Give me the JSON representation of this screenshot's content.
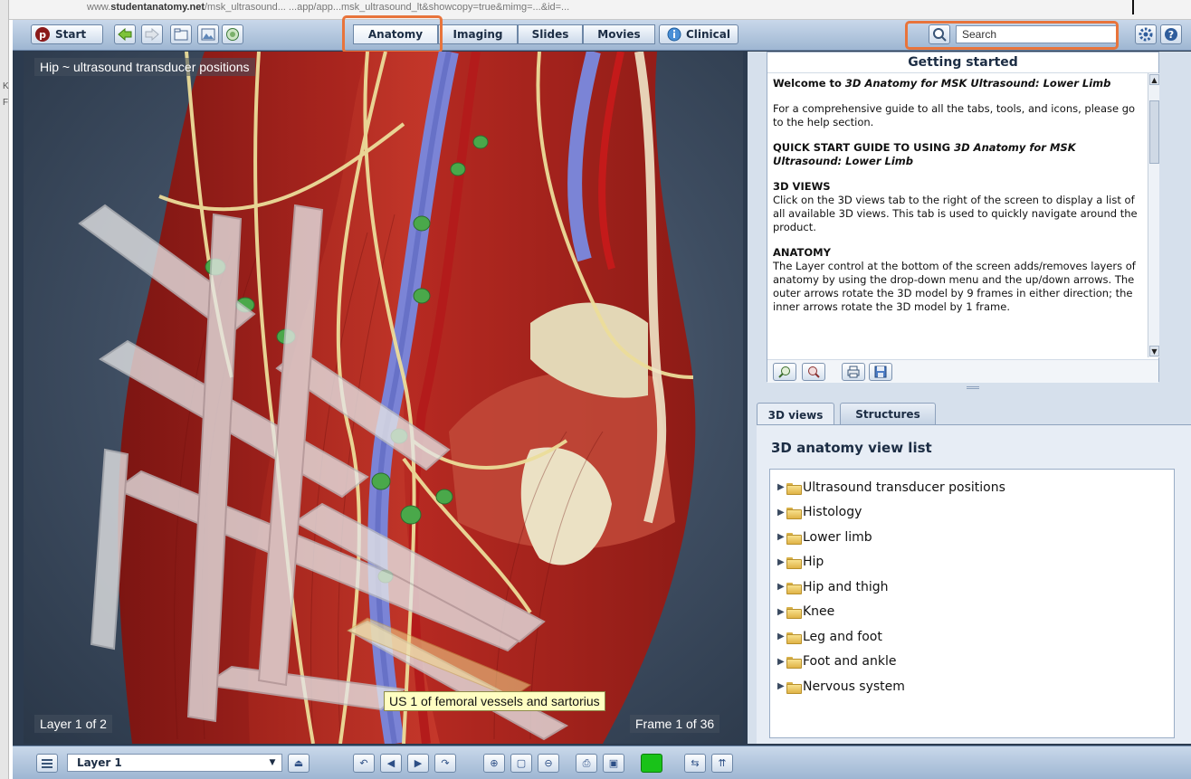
{
  "browser": {
    "url_prefix": "www.",
    "url_domain": "studentanatomy.net",
    "url_rest": "/msk_ultrasound...     ...app/app...msk_ultrasound_lt&showcopy=true&mimg=...&id=..."
  },
  "toolbar": {
    "start_label": "Start",
    "tabs": [
      "Anatomy",
      "Imaging",
      "Slides",
      "Movies"
    ],
    "clinical_label": "Clinical",
    "search_placeholder": "Search"
  },
  "viewer": {
    "title": "Hip ~ ultrasound transducer positions",
    "layer_indicator": "Layer 1 of 2",
    "frame_indicator": "Frame 1 of 36",
    "tooltip": "US 1 of femoral vessels and sartorius"
  },
  "getting_started": {
    "title": "Getting started",
    "welcome_prefix": "Welcome to ",
    "welcome_product": "3D Anatomy for MSK Ultrasound: Lower Limb",
    "intro": "For a comprehensive guide to all the tabs, tools, and icons, please go to the help section.",
    "quick_start_prefix": "QUICK START GUIDE TO USING ",
    "quick_start_product": "3D Anatomy for MSK Ultrasound: Lower Limb",
    "views_heading": "3D VIEWS",
    "views_text": "Click on the 3D views tab to the right of the screen to display a list of all available 3D views. This tab is used to quickly navigate around the product.",
    "anatomy_heading": "ANATOMY",
    "anatomy_text": "The Layer control at the bottom of the screen adds/removes layers of anatomy by using the drop-down menu and the up/down arrows. The outer arrows rotate the 3D model by 9 frames in either direction; the inner arrows rotate the 3D model by 1 frame."
  },
  "views_panel": {
    "tabs": [
      "3D views",
      "Structures"
    ],
    "title": "3D anatomy view list",
    "items": [
      "Ultrasound transducer positions",
      "Histology",
      "Lower limb",
      "Hip",
      "Hip and thigh",
      "Knee",
      "Leg and foot",
      "Foot and ankle",
      "Nervous system"
    ]
  },
  "bottom_bar": {
    "layer_value": "Layer 1"
  },
  "colors": {
    "highlight": "#e8743b",
    "toolbar": "#b3c7df",
    "layer_swatch": "#19c219"
  },
  "icons": {
    "back": "back-arrow-icon",
    "forward": "forward-arrow-icon",
    "folder": "folder-icon",
    "camera": "camera-icon",
    "search": "search-icon",
    "settings": "gear-icon",
    "help": "help-icon"
  }
}
